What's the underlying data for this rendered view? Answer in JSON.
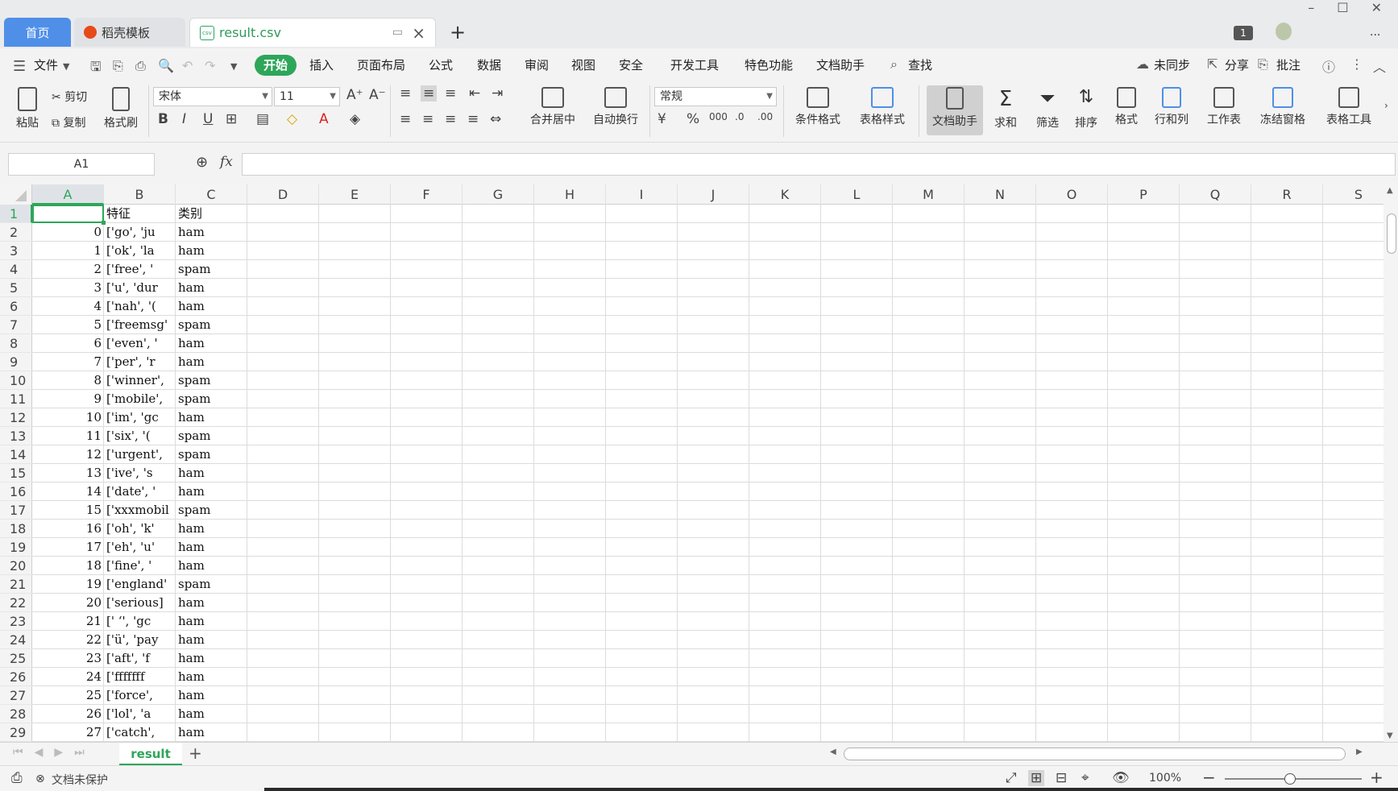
{
  "tabs": {
    "home": "首页",
    "daoke": "稻壳模板",
    "file": "result.csv",
    "file_badge": "csv"
  },
  "window": {
    "badge": "1",
    "more": "..."
  },
  "menu": {
    "file": "文件",
    "start": "开始",
    "items": [
      "插入",
      "页面布局",
      "公式",
      "数据",
      "审阅",
      "视图",
      "安全",
      "开发工具",
      "特色功能",
      "文档助手"
    ],
    "search": "查找",
    "sync": "未同步",
    "share": "分享",
    "comment": "批注"
  },
  "ribbon": {
    "paste": "粘贴",
    "cut": "剪切",
    "copy": "复制",
    "format_painter": "格式刷",
    "font_name": "宋体",
    "font_size": "11",
    "merge": "合并居中",
    "wrap": "自动换行",
    "number_format": "常规",
    "cond_format": "条件格式",
    "table_style": "表格样式",
    "doc_assistant": "文档助手",
    "sum": "求和",
    "filter": "筛选",
    "sort": "排序",
    "format": "格式",
    "row_col": "行和列",
    "worksheet": "工作表",
    "freeze": "冻结窗格",
    "table_tools": "表格工具"
  },
  "formula_bar": {
    "cell_ref": "A1",
    "fx": "fx",
    "content": ""
  },
  "columns": [
    "A",
    "B",
    "C",
    "D",
    "E",
    "F",
    "G",
    "H",
    "I",
    "J",
    "K",
    "L",
    "M",
    "N",
    "O",
    "P",
    "Q",
    "R",
    "S"
  ],
  "row_numbers": [
    "1",
    "2",
    "3",
    "4",
    "5",
    "6",
    "7",
    "8",
    "9",
    "10",
    "11",
    "12",
    "13",
    "14",
    "15",
    "16",
    "17",
    "18",
    "19",
    "20",
    "21",
    "22",
    "23",
    "24",
    "25",
    "26",
    "27",
    "28",
    "29"
  ],
  "rows": [
    {
      "a": "",
      "b": "特征",
      "c": "类别"
    },
    {
      "a": "0",
      "b": "['go', 'ju",
      "c": "ham"
    },
    {
      "a": "1",
      "b": "['ok', 'la",
      "c": "ham"
    },
    {
      "a": "2",
      "b": "['free', '",
      "c": "spam"
    },
    {
      "a": "3",
      "b": "['u', 'dur",
      "c": "ham"
    },
    {
      "a": "4",
      "b": "['nah', '(",
      "c": "ham"
    },
    {
      "a": "5",
      "b": "['freemsg'",
      "c": "spam"
    },
    {
      "a": "6",
      "b": "['even', '",
      "c": "ham"
    },
    {
      "a": "7",
      "b": "['per', 'r",
      "c": "ham"
    },
    {
      "a": "8",
      "b": "['winner',",
      "c": "spam"
    },
    {
      "a": "9",
      "b": "['mobile',",
      "c": "spam"
    },
    {
      "a": "10",
      "b": "['im', 'gc",
      "c": "ham"
    },
    {
      "a": "11",
      "b": "['six', '(",
      "c": "spam"
    },
    {
      "a": "12",
      "b": "['urgent',",
      "c": "spam"
    },
    {
      "a": "13",
      "b": "['ive', 's",
      "c": "ham"
    },
    {
      "a": "14",
      "b": "['date', '",
      "c": "ham"
    },
    {
      "a": "15",
      "b": "['xxxmobil",
      "c": "spam"
    },
    {
      "a": "16",
      "b": "['oh', 'k'",
      "c": "ham"
    },
    {
      "a": "17",
      "b": "['eh', 'u'",
      "c": "ham"
    },
    {
      "a": "18",
      "b": "['fine', '",
      "c": "ham"
    },
    {
      "a": "19",
      "b": "['england'",
      "c": "spam"
    },
    {
      "a": "20",
      "b": "['serious]",
      "c": "ham"
    },
    {
      "a": "21",
      "b": "[' ‘', 'gc",
      "c": "ham"
    },
    {
      "a": "22",
      "b": "['ü', 'pay",
      "c": "ham"
    },
    {
      "a": "23",
      "b": "['aft', 'f",
      "c": "ham"
    },
    {
      "a": "24",
      "b": "['fffffff",
      "c": "ham"
    },
    {
      "a": "25",
      "b": "['force',",
      "c": "ham"
    },
    {
      "a": "26",
      "b": "['lol', 'a",
      "c": "ham"
    },
    {
      "a": "27",
      "b": "['catch',",
      "c": "ham"
    }
  ],
  "sheets": {
    "active": "result"
  },
  "status": {
    "protect": "文档未保护",
    "zoom": "100%"
  }
}
